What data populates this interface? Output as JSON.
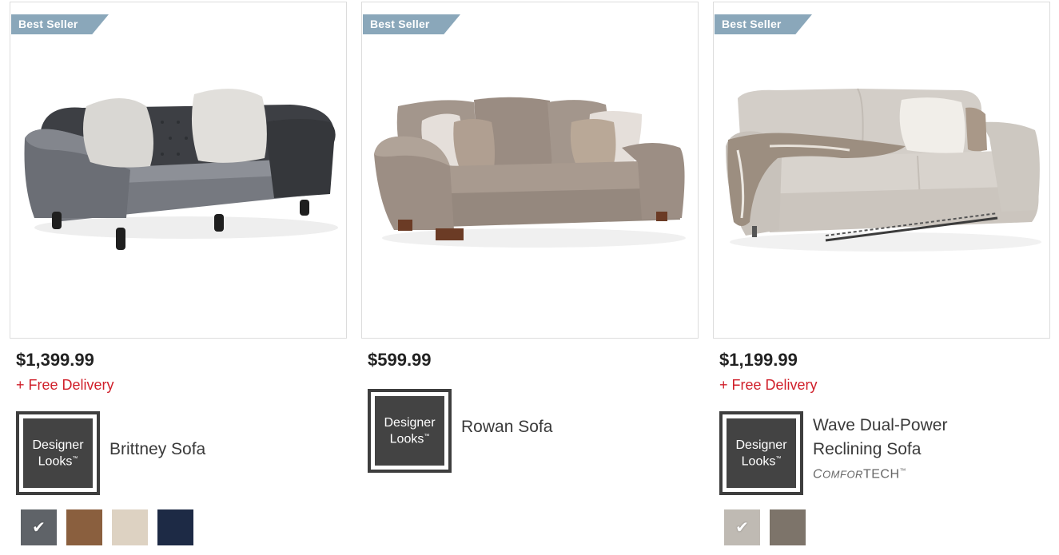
{
  "products": [
    {
      "badge": "Best Seller",
      "price": "$1,399.99",
      "delivery": "+ Free Delivery",
      "brand": {
        "line1": "Designer",
        "line2": "Looks",
        "tm": "™"
      },
      "name_line1": "Brittney Sofa",
      "name_line2": "",
      "swatches": [
        {
          "color": "#5f6368",
          "selected": true
        },
        {
          "color": "#8a5f3e",
          "selected": false
        },
        {
          "color": "#ddd2c2",
          "selected": false
        },
        {
          "color": "#1d2a45",
          "selected": false
        }
      ],
      "check_glyph": "✔"
    },
    {
      "badge": "Best Seller",
      "price": "$599.99",
      "brand": {
        "line1": "Designer",
        "line2": "Looks",
        "tm": "™"
      },
      "name_line1": "Rowan Sofa"
    },
    {
      "badge": "Best Seller",
      "price": "$1,199.99",
      "delivery": "+ Free Delivery",
      "brand": {
        "line1": "Designer",
        "line2": "Looks",
        "tm": "™"
      },
      "name_line1": "Wave Dual-Power",
      "name_line2": "Reclining Sofa",
      "subbrand": {
        "c": "C",
        "omfor": "OMFOR",
        "tech": "TECH",
        "tm": "™"
      },
      "swatches": [
        {
          "color": "#bfbab3",
          "selected": true
        },
        {
          "color": "#7d746a",
          "selected": false
        }
      ],
      "check_glyph": "✔"
    }
  ],
  "colors": {
    "ribbon": "#8aa7ba",
    "delivery": "#d01f2a",
    "logo_bg": "#434343"
  }
}
